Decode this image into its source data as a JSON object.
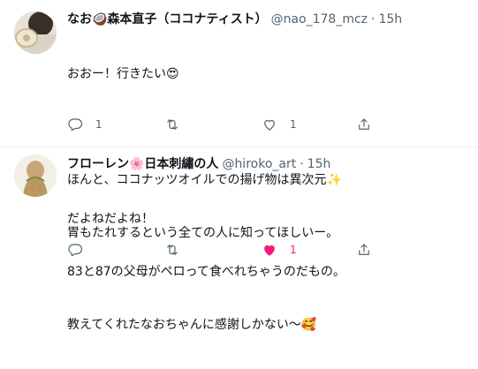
{
  "tweets": [
    {
      "display_name": "なお🥥森本直子（ココナティスト）",
      "handle": "@nao_178_mcz",
      "time": "15h",
      "lines": [
        "おおー！行きたい😍",
        "",
        "ほんと、ココナッツオイルでの揚げ物は異次元✨",
        "胃もたれするという全ての人に知ってほしいー。"
      ],
      "reply_count": "1",
      "retweet_count": "",
      "like_count": "1",
      "liked": false
    },
    {
      "display_name": "フローレン🌸日本刺繡の人",
      "handle": "@hiroko_art",
      "time": "15h",
      "lines": [
        "だよねだよね！",
        "83と87の父母がペロって食べれちゃうのだもの。",
        "教えてくれたなおちゃんに感謝しかない〜🥰"
      ],
      "reply_count": "",
      "retweet_count": "",
      "like_count": "1",
      "liked": true
    }
  ],
  "colors": {
    "text": "#0f1419",
    "secondary": "#536471",
    "like_active": "#f91880",
    "divider": "#eff3f4"
  },
  "icons": [
    "reply-icon",
    "retweet-icon",
    "like-icon",
    "share-icon"
  ]
}
